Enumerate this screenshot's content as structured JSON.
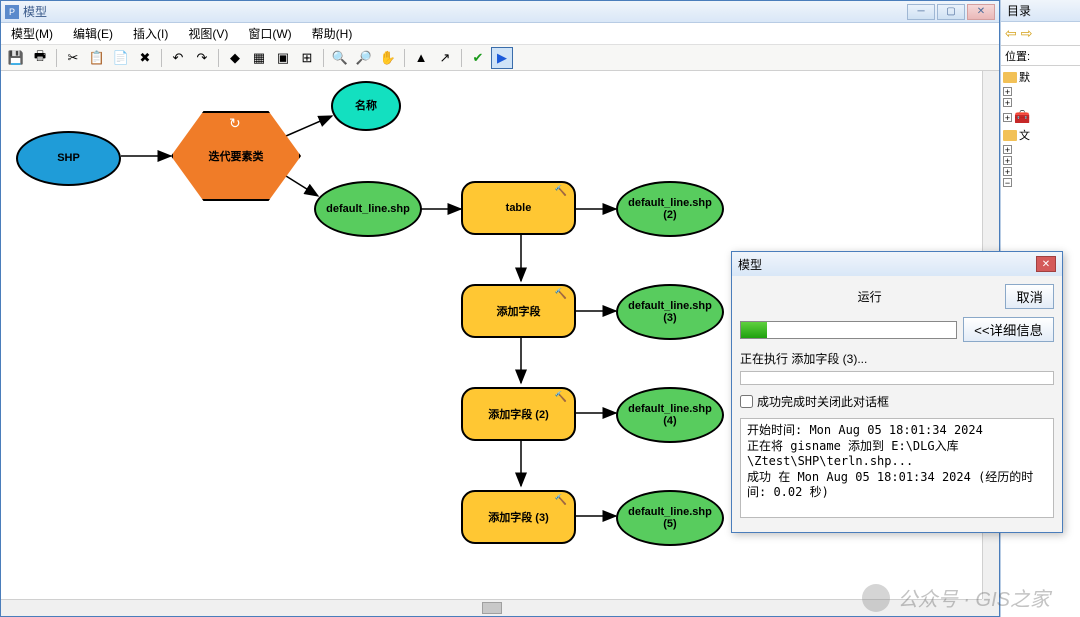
{
  "window": {
    "title": "模型"
  },
  "menu": {
    "model": "模型(M)",
    "edit": "编辑(E)",
    "insert": "插入(I)",
    "view": "视图(V)",
    "window": "窗口(W)",
    "help": "帮助(H)"
  },
  "nodes": {
    "shp": "SHP",
    "iterate": "迭代要素类",
    "name": "名称",
    "default_line": "default_line.shp",
    "table": "table",
    "dl2": "default_line.shp (2)",
    "addfield": "添加字段",
    "dl3": "default_line.shp (3)",
    "addfield2": "添加字段 (2)",
    "dl4": "default_line.shp (4)",
    "addfield3": "添加字段 (3)",
    "dl5": "default_line.shp (5)"
  },
  "dialog": {
    "title": "模型",
    "run": "运行",
    "cancel": "取消",
    "details": "<<详细信息",
    "status": "正在执行 添加字段 (3)...",
    "checkbox": "成功完成时关闭此对话框",
    "log": "开始时间: Mon Aug 05 18:01:34 2024\n正在将 gisname 添加到 E:\\DLG入库\\Ztest\\SHP\\terln.shp...\n成功 在 Mon Aug 05 18:01:34 2024 (经历的时间: 0.02 秒)"
  },
  "catalog": {
    "title": "目录",
    "location": "位置:",
    "default_gdb": "默",
    "docs": "文"
  },
  "watermark": {
    "text": "公众号 · GIS之家"
  }
}
